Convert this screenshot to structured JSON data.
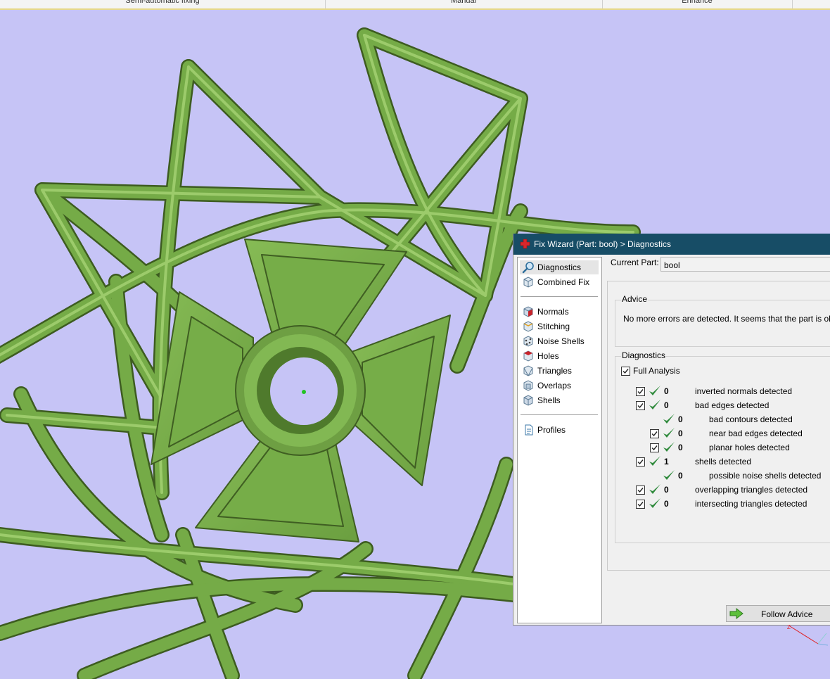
{
  "toolbar": {
    "tabs": [
      "Semi-automatic fixing",
      "Manual",
      "Enhance"
    ]
  },
  "dialog": {
    "title": "Fix Wizard (Part: bool) > Diagnostics",
    "nav": {
      "top": [
        {
          "label": "Diagnostics",
          "icon": "magnifier-icon"
        },
        {
          "label": "Combined Fix",
          "icon": "cube-icon"
        }
      ],
      "fixes": [
        {
          "label": "Normals",
          "icon": "normals-icon"
        },
        {
          "label": "Stitching",
          "icon": "stitching-icon"
        },
        {
          "label": "Noise Shells",
          "icon": "noise-shells-icon"
        },
        {
          "label": "Holes",
          "icon": "holes-icon"
        },
        {
          "label": "Triangles",
          "icon": "triangles-icon"
        },
        {
          "label": "Overlaps",
          "icon": "overlaps-icon"
        },
        {
          "label": "Shells",
          "icon": "shells-icon"
        }
      ],
      "bottom": [
        {
          "label": "Profiles",
          "icon": "document-icon"
        }
      ]
    },
    "current_part_label": "Current Part:",
    "current_part_value": "bool",
    "advice_title": "Advice",
    "advice_text": "No more errors are detected. It seems that the part is ok.",
    "diagnostics_title": "Diagnostics",
    "full_analysis_label": "Full Analysis",
    "rows": [
      {
        "checkbox": true,
        "count": "0",
        "label": "inverted normals detected",
        "level": 0
      },
      {
        "checkbox": true,
        "count": "0",
        "label": "bad edges detected",
        "level": 0
      },
      {
        "checkbox": false,
        "count": "0",
        "label": "bad contours detected",
        "level": 1
      },
      {
        "checkbox": true,
        "count": "0",
        "label": "near bad edges detected",
        "level": 1
      },
      {
        "checkbox": true,
        "count": "0",
        "label": "planar holes detected",
        "level": 1
      },
      {
        "checkbox": true,
        "count": "1",
        "label": "shells detected",
        "level": 0
      },
      {
        "checkbox": false,
        "count": "0",
        "label": "possible noise shells detected",
        "level": 1
      },
      {
        "checkbox": true,
        "count": "0",
        "label": "overlapping triangles detected",
        "level": 0
      },
      {
        "checkbox": true,
        "count": "0",
        "label": "intersecting triangles detected",
        "level": 0
      }
    ],
    "follow_advice_label": "Follow Advice"
  },
  "colors": {
    "viewport_bg": "#c6c4f6",
    "model_green": "#72a846",
    "titlebar": "#174d66",
    "check_green": "#2f8a3c"
  }
}
